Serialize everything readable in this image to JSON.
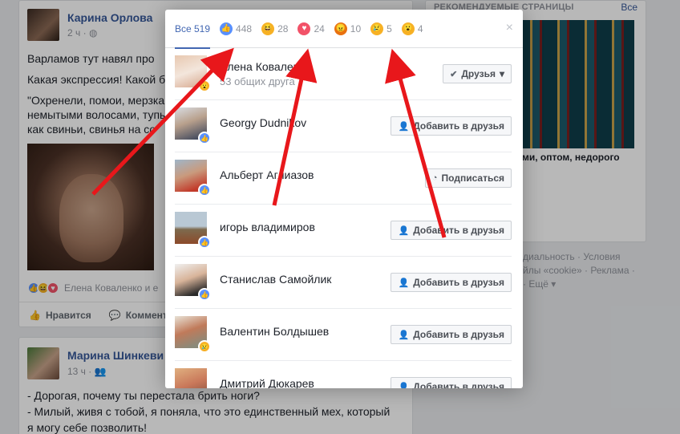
{
  "colors": {
    "like": "#5890ff",
    "haha": "#f7b125",
    "love": "#f25268",
    "angry": "#e9710f",
    "sad": "#f7b125",
    "wow": "#f7b125",
    "arrow": "#e8171b",
    "link": "#365899"
  },
  "post1": {
    "author": "Карина Орлова",
    "time": "2 ч ·",
    "time_icon": "globe-icon",
    "lines": [
      "Варламов тут навял про",
      "Какая экспрессия! Какой б",
      "\"Охренели, помои, мерзка",
      "немытыми волосами, тупы",
      "как свиньи, свинья на со"
    ],
    "reactions_text": "Елена Коваленко и е",
    "like_label": "Нравится",
    "comment_label": "Коммент"
  },
  "post2": {
    "author": "Марина Шинкеви",
    "time": "13 ч ·",
    "lines": [
      "- Дорогая, почему ты перестала брить ноги?",
      "- Милый, живя с тобой, я поняла, что это единственный мех, который",
      "я могу себе позволить!"
    ]
  },
  "right_column": {
    "header": "РЕКОМЕНДУЕМЫЕ СТРАНИЦЫ",
    "see_all": "Все",
    "caption": "ми, оптом, недорого",
    "footer": [
      "диальность · Условия",
      "йлы «cookie» · Реклама ·",
      "· Ещё ▾"
    ]
  },
  "modal": {
    "tabs": [
      {
        "id": "all",
        "label": "Все 519",
        "icon": ""
      },
      {
        "id": "like",
        "label": "448",
        "icon": "like-icon"
      },
      {
        "id": "haha",
        "label": "28",
        "icon": "haha-icon"
      },
      {
        "id": "love",
        "label": "24",
        "icon": "love-icon"
      },
      {
        "id": "angry",
        "label": "10",
        "icon": "angry-icon"
      },
      {
        "id": "sad",
        "label": "5",
        "icon": "sad-icon"
      },
      {
        "id": "wow",
        "label": "4",
        "icon": "wow-icon"
      }
    ],
    "close": "×",
    "people": [
      {
        "name": "Елена Коваленко",
        "sub": "53 общих друга",
        "reaction": "wow",
        "button": "Друзья",
        "button_icon": "check-icon",
        "button_arrow": "▾"
      },
      {
        "name": "Georgy Dudnikov",
        "sub": "",
        "reaction": "like",
        "button": "Добавить в друзья",
        "button_icon": "add-friend-icon"
      },
      {
        "name": "Альберт Аглиазов",
        "sub": "",
        "reaction": "like",
        "button": "Подписаться",
        "button_icon": "rss-icon"
      },
      {
        "name": "игорь владимиров",
        "sub": "",
        "reaction": "like",
        "button": "Добавить в друзья",
        "button_icon": "add-friend-icon"
      },
      {
        "name": "Станислав Самойлик",
        "sub": "",
        "reaction": "like",
        "button": "Добавить в друзья",
        "button_icon": "add-friend-icon"
      },
      {
        "name": "Валентин Болдышев",
        "sub": "",
        "reaction": "sad",
        "button": "Добавить в друзья",
        "button_icon": "add-friend-icon"
      },
      {
        "name": "Дмитрий Дюкарев",
        "sub": "",
        "reaction": "like",
        "button": "Добавить в друзья",
        "button_icon": "add-friend-icon"
      }
    ]
  }
}
